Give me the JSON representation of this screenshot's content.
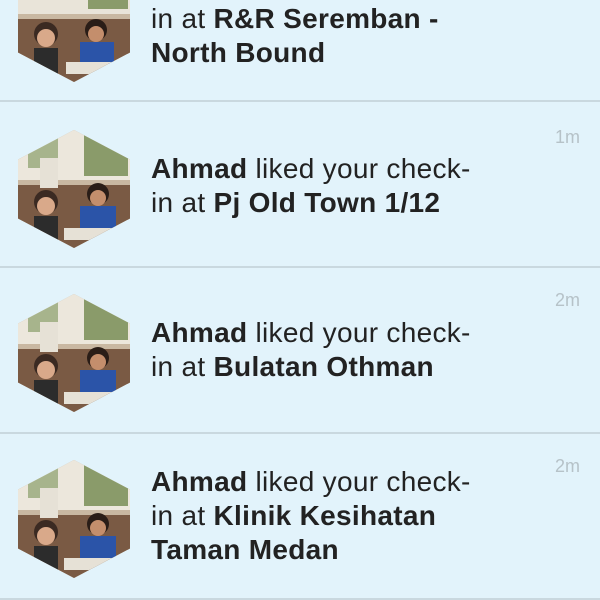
{
  "notifications": [
    {
      "user": "",
      "action_line1": "",
      "action_line2": "in at ",
      "place": "R&R Seremban -\nNorth Bound",
      "time": ""
    },
    {
      "user": "Ahmad",
      "action_line1": " liked your check-",
      "action_line2": "in at ",
      "place": "Pj Old Town 1/12",
      "time": "1m"
    },
    {
      "user": "Ahmad",
      "action_line1": " liked your check-",
      "action_line2": "in at ",
      "place": "Bulatan Othman",
      "time": "2m"
    },
    {
      "user": "Ahmad",
      "action_line1": " liked your check-",
      "action_line2": "in at ",
      "place": "Klinik Kesihatan\nTaman Medan",
      "time": "2m"
    }
  ],
  "avatar_icon": "user-photo-icon",
  "colors": {
    "background": "#e2f3fb",
    "divider": "#c9d8df",
    "text": "#222222",
    "time": "#b6c2c8"
  }
}
